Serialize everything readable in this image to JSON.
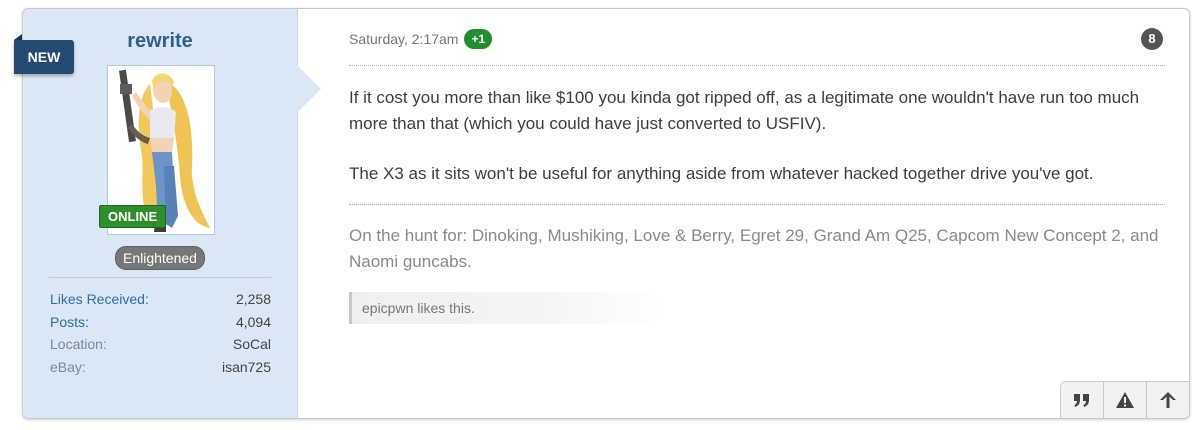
{
  "user": {
    "username": "rewrite",
    "status_badge": "ONLINE",
    "title": "Enlightened",
    "stats": [
      {
        "label": "Likes Received:",
        "value": "2,258"
      },
      {
        "label": "Posts:",
        "value": "4,094"
      },
      {
        "label": "Location:",
        "value": "SoCal"
      },
      {
        "label": "eBay:",
        "value": "isan725"
      }
    ]
  },
  "ribbon": {
    "label": "NEW"
  },
  "post": {
    "timestamp": "Saturday, 2:17am",
    "rating_badge": "+1",
    "number": "8",
    "paragraphs": [
      "If it cost you more than like $100 you kinda got ripped off, as a legitimate one wouldn't have run too much more than that (which you could have just converted to USFIV).",
      "The X3 as it sits won't be useful for anything aside from whatever hacked together drive you've got."
    ],
    "signature": "On the hunt for: Dinoking, Mushiking, Love & Berry, Egret 29, Grand Am Q25, Capcom New Concept 2, and Naomi guncabs.",
    "likes_text": "epicpwn likes this."
  },
  "actions": [
    {
      "name": "quote-button",
      "icon": "quote-icon"
    },
    {
      "name": "report-button",
      "icon": "warning-icon"
    },
    {
      "name": "scroll-top-button",
      "icon": "arrow-up-icon"
    }
  ],
  "colors": {
    "sidebar_bg": "#dce7f5",
    "username": "#2f5f8e",
    "online_green": "#2f8f2f",
    "ribbon_navy": "#254b73",
    "link_blue": "#2e6ca9"
  }
}
